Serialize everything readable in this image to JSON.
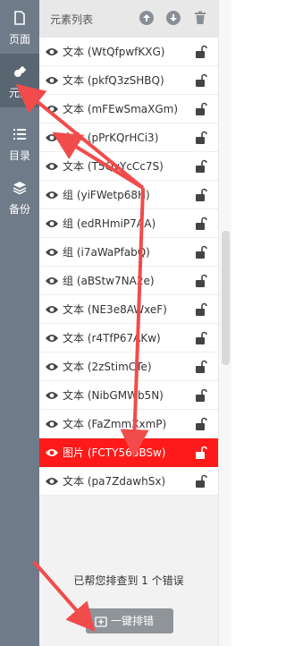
{
  "sidebar": {
    "items": [
      {
        "label": "页面",
        "icon": "page-icon"
      },
      {
        "label": "元素",
        "icon": "elements-icon"
      },
      {
        "label": "目录",
        "icon": "list-icon"
      },
      {
        "label": "备份",
        "icon": "backup-icon"
      }
    ]
  },
  "panel": {
    "title": "元素列表",
    "header_icons": [
      "move-up-icon",
      "move-down-icon",
      "trash-icon"
    ]
  },
  "elements": [
    {
      "label": "文本 (WtQfpwfKXG)"
    },
    {
      "label": "文本 (pkfQ3zSHBQ)"
    },
    {
      "label": "文本 (mFEwSmaXGm)"
    },
    {
      "label": "文本 (pPrKQrHCi3)"
    },
    {
      "label": "文本 (T5QyYcCc7S)"
    },
    {
      "label": "组 (yiFWetp68H)"
    },
    {
      "label": "组 (edRHmiP7AA)"
    },
    {
      "label": "组 (i7aWaPfabQ)"
    },
    {
      "label": "组 (aBStw7NA2e)"
    },
    {
      "label": "文本 (NE3e8AWxeF)"
    },
    {
      "label": "文本 (r4TfP67AKw)"
    },
    {
      "label": "文本 (2zStimCTe)"
    },
    {
      "label": "文本 (NibGMWb5N)"
    },
    {
      "label": "文本 (FaZmmXxmP)"
    },
    {
      "label": "图片 (FCTY568BSw)"
    },
    {
      "label": "文本 (pa7ZdawhSx)"
    }
  ],
  "footer": {
    "message": "已帮您排查到 1 个错误",
    "fix_button": "一键排错"
  },
  "colors": {
    "sidebar": "#6f7b88",
    "selected_row": "#ff1a1a",
    "annotation_arrow": "#f24b4b"
  }
}
